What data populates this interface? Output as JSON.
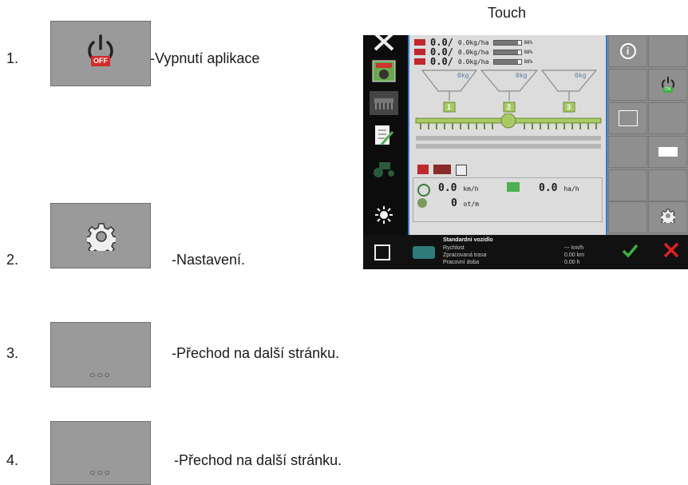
{
  "touch_label": "Touch",
  "items": [
    {
      "number": "1.",
      "description": "-Vypnutí aplikace",
      "icon": "power-off-icon",
      "off_badge": "OFF"
    },
    {
      "number": "2.",
      "description": "-Nastavení.",
      "icon": "gear-icon"
    },
    {
      "number": "3.",
      "description": "-Přechod na další stránku.",
      "icon": "ellipsis-icon",
      "dots": "○○○"
    },
    {
      "number": "4.",
      "description": "-Přechod na další stránku.",
      "icon": "ellipsis-icon",
      "dots": "○○○"
    }
  ],
  "terminal": {
    "rates": [
      {
        "value": "0.0/",
        "unit": "0.0kg/ha",
        "level": "88%"
      },
      {
        "value": "0.0/",
        "unit": "0.0kg/ha",
        "level": "88%"
      },
      {
        "value": "0.0/",
        "unit": "0.0kg/ha",
        "level": "88%"
      }
    ],
    "hopper_labels": [
      "0kg",
      "0kg",
      "0kg"
    ],
    "section_numbers": [
      "1",
      "2",
      "3"
    ],
    "speed_value": "0.0",
    "speed_unit": "km/h",
    "area_value": "0.0",
    "area_unit": "ha/h",
    "rpm_value": "0",
    "rpm_unit": "ot/m",
    "right_icons": [
      "info-icon",
      "power-on-icon",
      "sensor-settings-icon",
      "pump-icon",
      "gear-icon"
    ],
    "on_badge": "ON",
    "vehicle": {
      "title": "Standardní vozidlo",
      "rows": [
        {
          "label": "Rychlost",
          "value": "--- km/h"
        },
        {
          "label": "Zpracovaná trasa",
          "value": "0.00 km"
        },
        {
          "label": "Pracovní doba",
          "value": "0.00 h"
        }
      ]
    },
    "colors": {
      "accent": "#3b78c8",
      "confirm": "#3cb043",
      "cancel": "#e02020",
      "off_badge": "#d42a2a"
    }
  }
}
